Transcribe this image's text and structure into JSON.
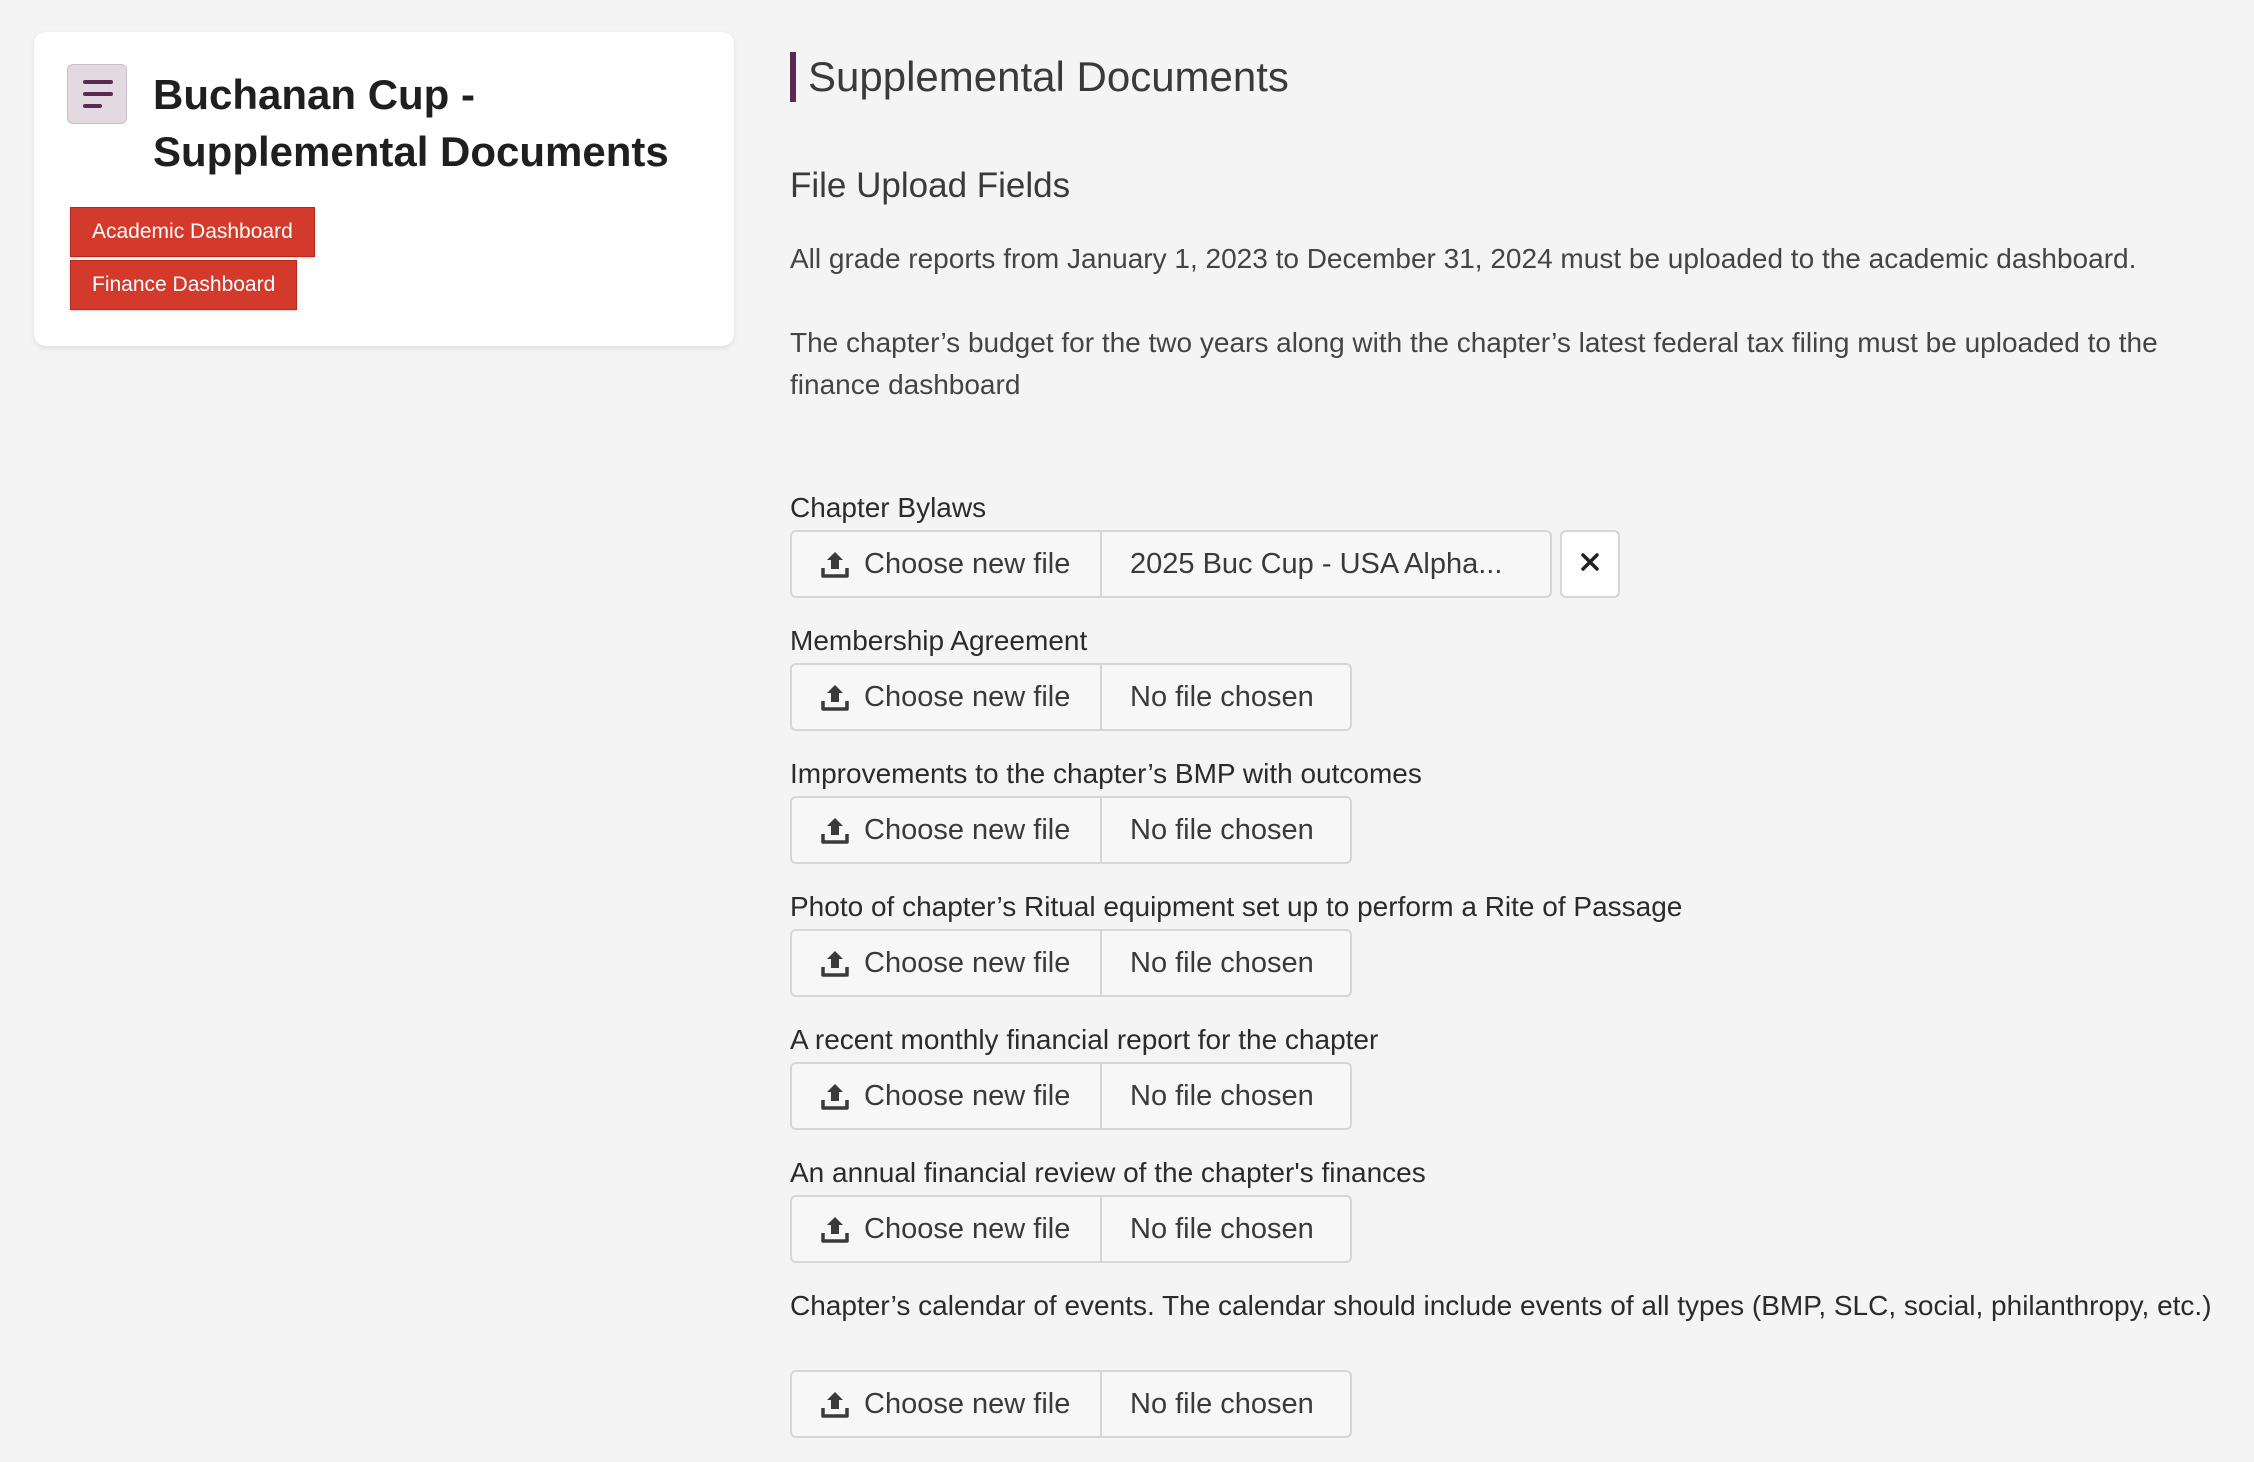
{
  "sidebar": {
    "menu_icon": "menu-lines-icon",
    "title": "Buchanan Cup - Supplemental Documents",
    "buttons": [
      {
        "label": "Academic Dashboard"
      },
      {
        "label": "Finance Dashboard"
      }
    ],
    "accent_color": "#d33a2c"
  },
  "main": {
    "heading": "Supplemental Documents",
    "subheading": "File Upload Fields",
    "paragraphs": [
      "All grade reports from January 1, 2023 to December 31, 2024 must be uploaded to the academic dashboard.",
      "The chapter’s budget for the two years along with the chapter’s latest federal tax filing must be uploaded to the finance dashboard"
    ],
    "choose_label": "Choose new file",
    "fields": [
      {
        "label": "Chapter Bylaws",
        "file": "2025 Buc Cup - USA Alpha..."
      },
      {
        "label": "Membership Agreement",
        "file": "No file chosen"
      },
      {
        "label": "Improvements to the chapter’s BMP with outcomes",
        "file": "No file chosen"
      },
      {
        "label": "Photo of chapter’s Ritual equipment set up to perform a Rite of Passage",
        "file": "No file chosen"
      },
      {
        "label": "A recent monthly financial report for the chapter",
        "file": "No file chosen"
      },
      {
        "label": "An annual financial review of the chapter's finances",
        "file": "No file chosen"
      },
      {
        "label": "Chapter’s calendar of events. The calendar should include events of all types (BMP, SLC, social, philanthropy, etc.)",
        "file": "No file chosen"
      }
    ]
  },
  "colors": {
    "brand": "#5a2a52",
    "button_red": "#d33a2c",
    "background": "#f4f4f4"
  }
}
